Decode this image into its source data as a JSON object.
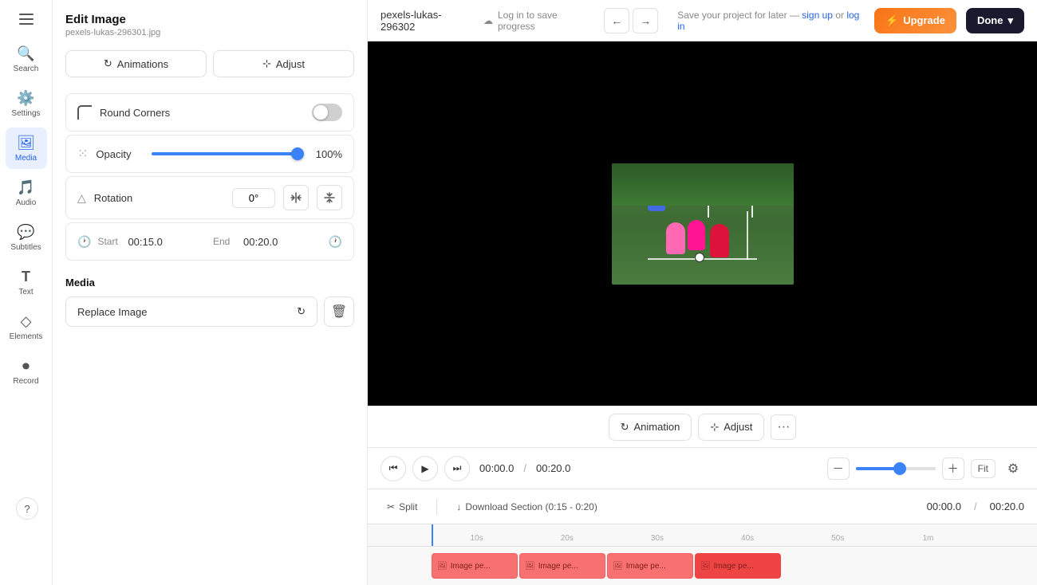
{
  "app": {
    "title": "Edit Image",
    "subtitle": "pexels-lukas-296301.jpg",
    "filename": "pexels-lukas-296302"
  },
  "topbar": {
    "filename": "pexels-lukas-296302",
    "save_status": "Log in to save progress",
    "save_later_text": "Save your project for later —",
    "sign_up": "sign up",
    "or": "or",
    "log_in": "log in",
    "upgrade_label": "Upgrade",
    "done_label": "Done"
  },
  "panel": {
    "tabs": [
      {
        "id": "animations",
        "label": "Animations"
      },
      {
        "id": "adjust",
        "label": "Adjust"
      }
    ],
    "round_corners": {
      "label": "Round Corners",
      "enabled": false
    },
    "opacity": {
      "label": "Opacity",
      "value": 100,
      "display": "100%"
    },
    "rotation": {
      "label": "Rotation",
      "value": "0°"
    },
    "start": {
      "label": "Start",
      "value": "00:15.0"
    },
    "end": {
      "label": "End",
      "value": "00:20.0"
    },
    "media_section": {
      "title": "Media",
      "replace_label": "Replace Image"
    }
  },
  "sidebar": {
    "items": [
      {
        "id": "search",
        "label": "Search",
        "icon": "🔍"
      },
      {
        "id": "settings",
        "label": "Settings",
        "icon": "⚙️"
      },
      {
        "id": "media",
        "label": "Media",
        "icon": "🖼"
      },
      {
        "id": "audio",
        "label": "Audio",
        "icon": "🎵"
      },
      {
        "id": "subtitles",
        "label": "Subtitles",
        "icon": "💬"
      },
      {
        "id": "text",
        "label": "Text",
        "icon": "T"
      },
      {
        "id": "elements",
        "label": "Elements",
        "icon": "◇"
      },
      {
        "id": "record",
        "label": "Record",
        "icon": "⏺"
      }
    ]
  },
  "context_bar": {
    "animation_btn": "Animation",
    "adjust_btn": "Adjust",
    "more_icon": "···"
  },
  "playback": {
    "current_time": "00:00.0",
    "total_time": "00:20.0",
    "fit_label": "Fit"
  },
  "timeline": {
    "split_label": "Split",
    "download_label": "Download Section (0:15 - 0:20)",
    "current_time": "00:00.0",
    "total_time": "00:20.0",
    "ruler_marks": [
      "10s",
      "20s",
      "30s",
      "40s",
      "50s",
      "1m"
    ],
    "clips": [
      {
        "label": "Image pe..."
      },
      {
        "label": "Image pe..."
      },
      {
        "label": "Image pe..."
      },
      {
        "label": "Image pe..."
      }
    ]
  }
}
